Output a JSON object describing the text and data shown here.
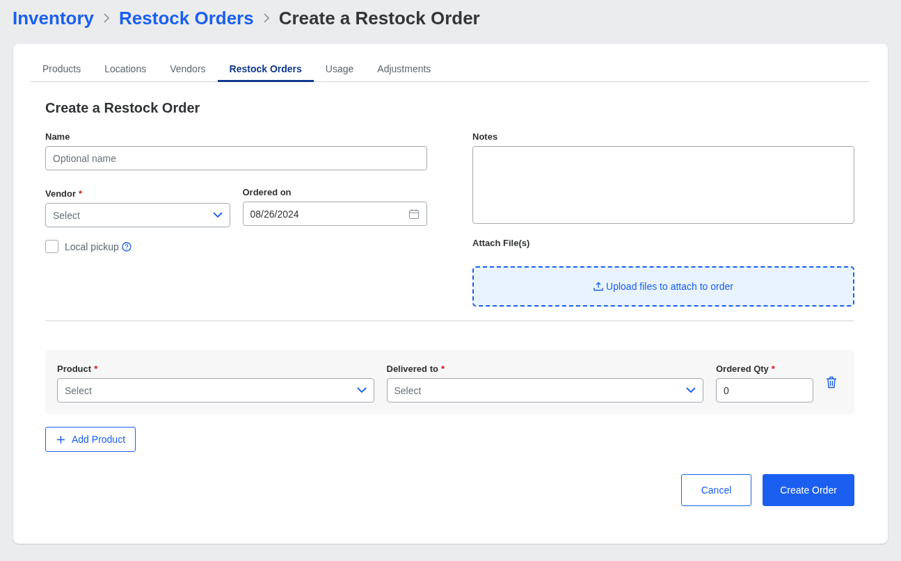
{
  "breadcrumb": [
    {
      "label": "Inventory",
      "kind": "link"
    },
    {
      "label": "Restock Orders",
      "kind": "link"
    },
    {
      "label": "Create a Restock Order",
      "kind": "current"
    }
  ],
  "tabs": [
    {
      "label": "Products",
      "selected": false
    },
    {
      "label": "Locations",
      "selected": false
    },
    {
      "label": "Vendors",
      "selected": false
    },
    {
      "label": "Restock Orders",
      "selected": true
    },
    {
      "label": "Usage",
      "selected": false
    },
    {
      "label": "Adjustments",
      "selected": false
    }
  ],
  "form": {
    "title": "Create a Restock Order",
    "name": {
      "label": "Name",
      "placeholder": "Optional name"
    },
    "vendor": {
      "label": "Vendor",
      "required_mark": "*",
      "placeholder": "Select"
    },
    "ordered_on": {
      "label": "Ordered on",
      "value": "08/26/2024"
    },
    "local_pickup": {
      "label": "Local pickup",
      "checked": false
    },
    "notes": {
      "label": "Notes"
    },
    "attach": {
      "label": "Attach File(s)",
      "dropzone": "Upload files to attach to order"
    }
  },
  "product_rows": [
    {
      "product": {
        "label": "Product",
        "required_mark": "*",
        "placeholder": "Select"
      },
      "delivered_to": {
        "label": "Delivered to",
        "required_mark": "*",
        "placeholder": "Select"
      },
      "ordered_qty": {
        "label": "Ordered Qty",
        "required_mark": "*",
        "value": "0"
      }
    }
  ],
  "add_product": "Add Product",
  "buttons": [
    {
      "label": "Cancel",
      "kind": "secondary"
    },
    {
      "label": "Create Order",
      "kind": "primary"
    }
  ]
}
